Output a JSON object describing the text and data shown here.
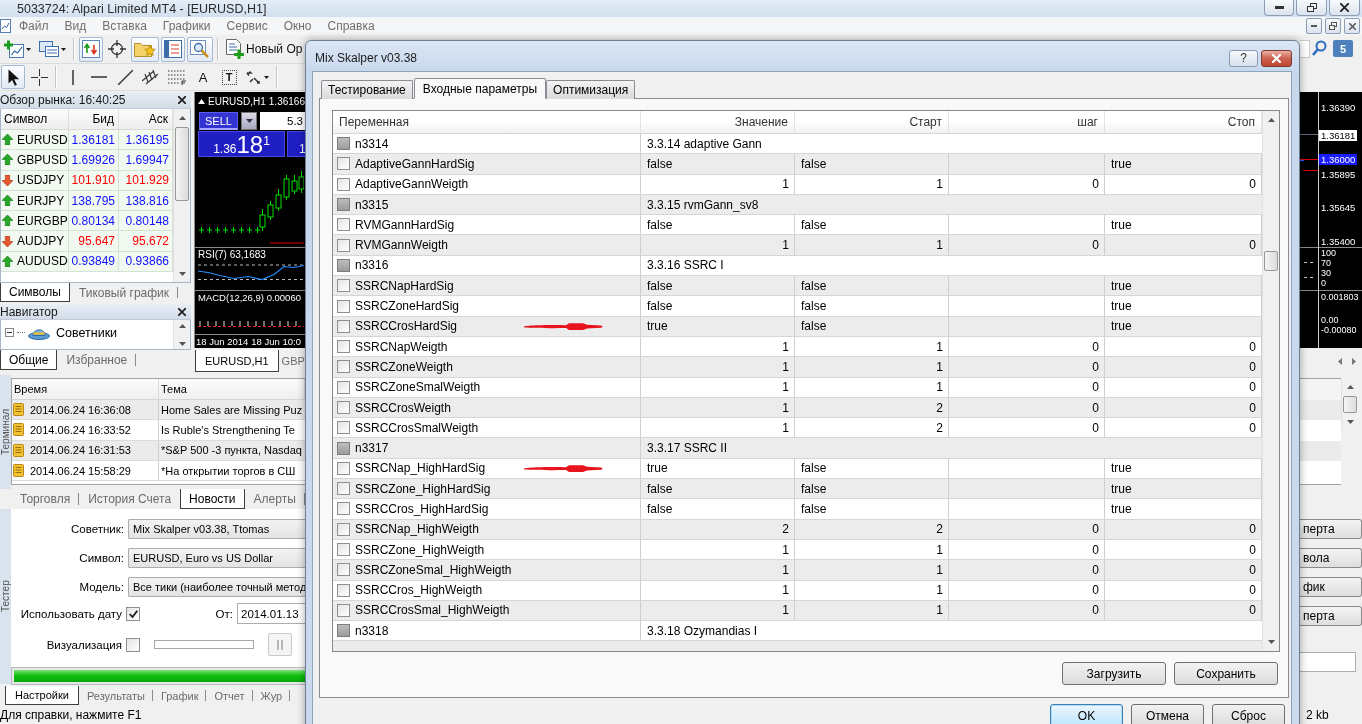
{
  "window": {
    "title": "5033724: Alpari Limited MT4 - [EURUSD,H1]"
  },
  "menu": [
    "Файл",
    "Вид",
    "Вставка",
    "Графики",
    "Сервис",
    "Окно",
    "Справка"
  ],
  "toolbar": {
    "buttons": [
      {
        "kind": "new-chart",
        "pressed": false
      },
      {
        "kind": "profiles",
        "pressed": false
      },
      {
        "kind": "market-watch",
        "pressed": true
      },
      {
        "kind": "data-window",
        "pressed": false
      },
      {
        "kind": "navigator",
        "pressed": true
      },
      {
        "kind": "terminal",
        "pressed": true
      },
      {
        "kind": "tester",
        "pressed": true
      }
    ],
    "new_order": "Новый Ор",
    "notifications": "5"
  },
  "drawing_tools": [
    {
      "kind": "cursor",
      "selected": true
    },
    {
      "kind": "crosshair",
      "selected": false
    },
    {
      "kind": "vertical-line",
      "selected": false
    },
    {
      "kind": "horizontal-line",
      "selected": false
    },
    {
      "kind": "trend-line",
      "selected": false
    },
    {
      "kind": "channel",
      "selected": false
    },
    {
      "kind": "fibonacci",
      "selected": false
    },
    {
      "kind": "text",
      "glyph": "A",
      "selected": false
    },
    {
      "kind": "label",
      "glyph": "T",
      "selected": false
    },
    {
      "kind": "arrows",
      "selected": false
    }
  ],
  "market_watch": {
    "title": "Обзор рынка: 16:40:25",
    "columns": [
      "Символ",
      "Бид",
      "Аск"
    ],
    "rows": [
      {
        "symbol": "EURUSD",
        "bid": "1.36181",
        "ask": "1.36195",
        "rising": true
      },
      {
        "symbol": "GBPUSD",
        "bid": "1.69926",
        "ask": "1.69947",
        "rising": true
      },
      {
        "symbol": "USDJPY",
        "bid": "101.910",
        "ask": "101.929",
        "rising": false
      },
      {
        "symbol": "EURJPY",
        "bid": "138.795",
        "ask": "138.816",
        "rising": true
      },
      {
        "symbol": "EURGBP",
        "bid": "0.80134",
        "ask": "0.80148",
        "rising": true
      },
      {
        "symbol": "AUDJPY",
        "bid": "95.647",
        "ask": "95.672",
        "rising": false
      },
      {
        "symbol": "AUDUSD",
        "bid": "0.93849",
        "ask": "0.93866",
        "rising": true
      }
    ],
    "tabs": [
      {
        "label": "Символы",
        "selected": true
      },
      {
        "label": "Тиковый график",
        "selected": false
      }
    ]
  },
  "navigator": {
    "title": "Навигатор",
    "items": [
      {
        "label": "Советники",
        "expanded": true
      }
    ],
    "tabs": [
      {
        "label": "Общие",
        "selected": true
      },
      {
        "label": "Избранное",
        "selected": false
      }
    ]
  },
  "chart": {
    "symbol": "EURUSD,H1",
    "quote": "1.36166",
    "sell": "SELL",
    "lot": "5.3",
    "bid_prefix": "1.36",
    "bid_big": "18",
    "bid_point": "1",
    "ask_prefix": "1",
    "rsi": "RSI(7) 63,1683",
    "macd": "MACD(12,26,9) 0.00060",
    "time_labels": [
      "18 Jun 2014",
      "18 Jun 10:0"
    ],
    "price_scale": [
      {
        "kind": "tick",
        "label": "1.36390"
      },
      {
        "kind": "bid",
        "label": "1.36181"
      },
      {
        "kind": "level",
        "label": "1.36000"
      },
      {
        "kind": "tick",
        "label": "1.35895"
      },
      {
        "kind": "tick",
        "label": "1.35645"
      },
      {
        "kind": "tick",
        "label": "1.35400"
      }
    ],
    "rsi_scale": [
      "100",
      "70",
      "30",
      "0"
    ],
    "macd_scale": [
      "0.001803",
      "0.00",
      "-0.00080"
    ],
    "tabs": [
      {
        "label": "EURUSD,H1",
        "selected": true
      },
      {
        "label": "GBP",
        "selected": false
      }
    ]
  },
  "terminal": {
    "side_label": "Терминал",
    "columns": [
      "Время",
      "Тема"
    ],
    "rows": [
      {
        "time": "2014.06.24 16:36:08",
        "subject": "Home Sales are Missing Puz"
      },
      {
        "time": "2014.06.24 16:33:52",
        "subject": "Is Ruble's Strengthening Te"
      },
      {
        "time": "2014.06.24 16:31:53",
        "subject": "*S&P 500 -3 пункта, Nasdaq"
      },
      {
        "time": "2014.06.24 15:58:29",
        "subject": "*На открытии торгов в СШ"
      }
    ],
    "tabs": [
      {
        "label": "Торговля",
        "selected": false
      },
      {
        "label": "История Счета",
        "selected": false
      },
      {
        "label": "Новости",
        "selected": true
      },
      {
        "label": "Алерты",
        "selected": false
      }
    ]
  },
  "tester": {
    "side_label": "Тестер",
    "fields": [
      {
        "label": "Советник:",
        "value": "Mix Skalper v03.38, Ttomas"
      },
      {
        "label": "Символ:",
        "value": "EURUSD, Euro vs US Dollar"
      },
      {
        "label": "Модель:",
        "value": "Все тики (наиболее точный метод"
      }
    ],
    "use_date": {
      "label": "Использовать дату",
      "checked": true
    },
    "from": {
      "label": "От:",
      "value": "2014.01.13"
    },
    "visual": {
      "label": "Визуализация",
      "checked": false
    },
    "pause": {
      "disabled": true
    },
    "progress": {
      "level": 1
    },
    "side_buttons": [
      "перта",
      "вола",
      "фик",
      "перта"
    ],
    "tabs": [
      {
        "label": "Настройки",
        "selected": true
      },
      {
        "label": "Результаты",
        "selected": false
      },
      {
        "label": "График",
        "selected": false
      },
      {
        "label": "Отчет",
        "selected": false
      },
      {
        "label": "Жур",
        "selected": false
      }
    ]
  },
  "status_bar": {
    "help": "Для справки, нажмите F1",
    "size": "2 kb"
  },
  "dialog": {
    "title": "Mix Skalper v03.38",
    "help": "?",
    "tabs": [
      {
        "label": "Тестирование",
        "selected": false
      },
      {
        "label": "Входные параметры",
        "selected": true
      },
      {
        "label": "Оптимизация",
        "selected": false
      }
    ],
    "table": {
      "columns": [
        "Переменная",
        "Значение",
        "Старт",
        "шаг",
        "Стоп"
      ],
      "rows": [
        {
          "kind": "group",
          "checked": false,
          "annotated": false,
          "name": "n3314",
          "title": "3.3.14 adaptive Gann"
        },
        {
          "kind": "bool",
          "checked": false,
          "annotated": false,
          "name": "AdaptiveGannHardSig",
          "value": "false",
          "start": "false",
          "stop": "true"
        },
        {
          "kind": "number",
          "checked": false,
          "annotated": false,
          "name": "AdaptiveGannWeigth",
          "value": "1",
          "start": "1",
          "step": "0",
          "stop": "0"
        },
        {
          "kind": "group",
          "checked": false,
          "annotated": false,
          "name": "n3315",
          "title": "3.3.15 rvmGann_sv8"
        },
        {
          "kind": "bool",
          "checked": false,
          "annotated": false,
          "name": "RVMGannHardSig",
          "value": "false",
          "start": "false",
          "stop": "true"
        },
        {
          "kind": "number",
          "checked": false,
          "annotated": false,
          "name": "RVMGannWeigth",
          "value": "1",
          "start": "1",
          "step": "0",
          "stop": "0"
        },
        {
          "kind": "group",
          "checked": false,
          "annotated": false,
          "name": "n3316",
          "title": "3.3.16 SSRC I"
        },
        {
          "kind": "bool",
          "checked": false,
          "annotated": false,
          "name": "SSRCNapHardSig",
          "value": "false",
          "start": "false",
          "stop": "true"
        },
        {
          "kind": "bool",
          "checked": false,
          "annotated": false,
          "name": "SSRCZoneHardSig",
          "value": "false",
          "start": "false",
          "stop": "true"
        },
        {
          "kind": "bool",
          "checked": false,
          "annotated": true,
          "name": "SSRCCrosHardSig",
          "value": "true",
          "start": "false",
          "stop": "true"
        },
        {
          "kind": "number",
          "checked": false,
          "annotated": false,
          "name": "SSRCNapWeigth",
          "value": "1",
          "start": "1",
          "step": "0",
          "stop": "0"
        },
        {
          "kind": "number",
          "checked": false,
          "annotated": false,
          "name": "SSRCZoneWeigth",
          "value": "1",
          "start": "1",
          "step": "0",
          "stop": "0"
        },
        {
          "kind": "number",
          "checked": false,
          "annotated": false,
          "name": "SSRCZoneSmalWeigth",
          "value": "1",
          "start": "1",
          "step": "0",
          "stop": "0"
        },
        {
          "kind": "number",
          "checked": false,
          "annotated": false,
          "name": "SSRCCrosWeigth",
          "value": "1",
          "start": "2",
          "step": "0",
          "stop": "0"
        },
        {
          "kind": "number",
          "checked": false,
          "annotated": false,
          "name": "SSRCCrosSmalWeigth",
          "value": "1",
          "start": "2",
          "step": "0",
          "stop": "0"
        },
        {
          "kind": "group",
          "checked": false,
          "annotated": false,
          "name": "n3317",
          "title": "3.3.17 SSRC II"
        },
        {
          "kind": "bool",
          "checked": false,
          "annotated": true,
          "name": "SSRCNap_HighHardSig",
          "value": "true",
          "start": "false",
          "stop": "true"
        },
        {
          "kind": "bool",
          "checked": false,
          "annotated": false,
          "name": "SSRCZone_HighHardSig",
          "value": "false",
          "start": "false",
          "stop": "true"
        },
        {
          "kind": "bool",
          "checked": false,
          "annotated": false,
          "name": "SSRCCros_HighHardSig",
          "value": "false",
          "start": "false",
          "stop": "true"
        },
        {
          "kind": "number",
          "checked": false,
          "annotated": false,
          "name": "SSRCNap_HighWeigth",
          "value": "2",
          "start": "2",
          "step": "0",
          "stop": "0"
        },
        {
          "kind": "number",
          "checked": false,
          "annotated": false,
          "name": "SSRCZone_HighWeigth",
          "value": "1",
          "start": "1",
          "step": "0",
          "stop": "0"
        },
        {
          "kind": "number",
          "checked": false,
          "annotated": false,
          "name": "SSRCZoneSmal_HighWeigth",
          "value": "1",
          "start": "1",
          "step": "0",
          "stop": "0"
        },
        {
          "kind": "number",
          "checked": false,
          "annotated": false,
          "name": "SSRCCros_HighWeigth",
          "value": "1",
          "start": "1",
          "step": "0",
          "stop": "0"
        },
        {
          "kind": "number",
          "checked": false,
          "annotated": false,
          "name": "SSRCCrosSmal_HighWeigth",
          "value": "1",
          "start": "1",
          "step": "0",
          "stop": "0"
        },
        {
          "kind": "group",
          "checked": false,
          "annotated": false,
          "name": "n3318",
          "title": "3.3.18 Ozymandias I"
        }
      ]
    },
    "buttons": [
      "Загрузить",
      "Сохранить"
    ],
    "footer": [
      {
        "label": "OK",
        "default": true
      },
      {
        "label": "Отмена",
        "default": false
      },
      {
        "label": "Сброс",
        "default": false
      }
    ]
  }
}
